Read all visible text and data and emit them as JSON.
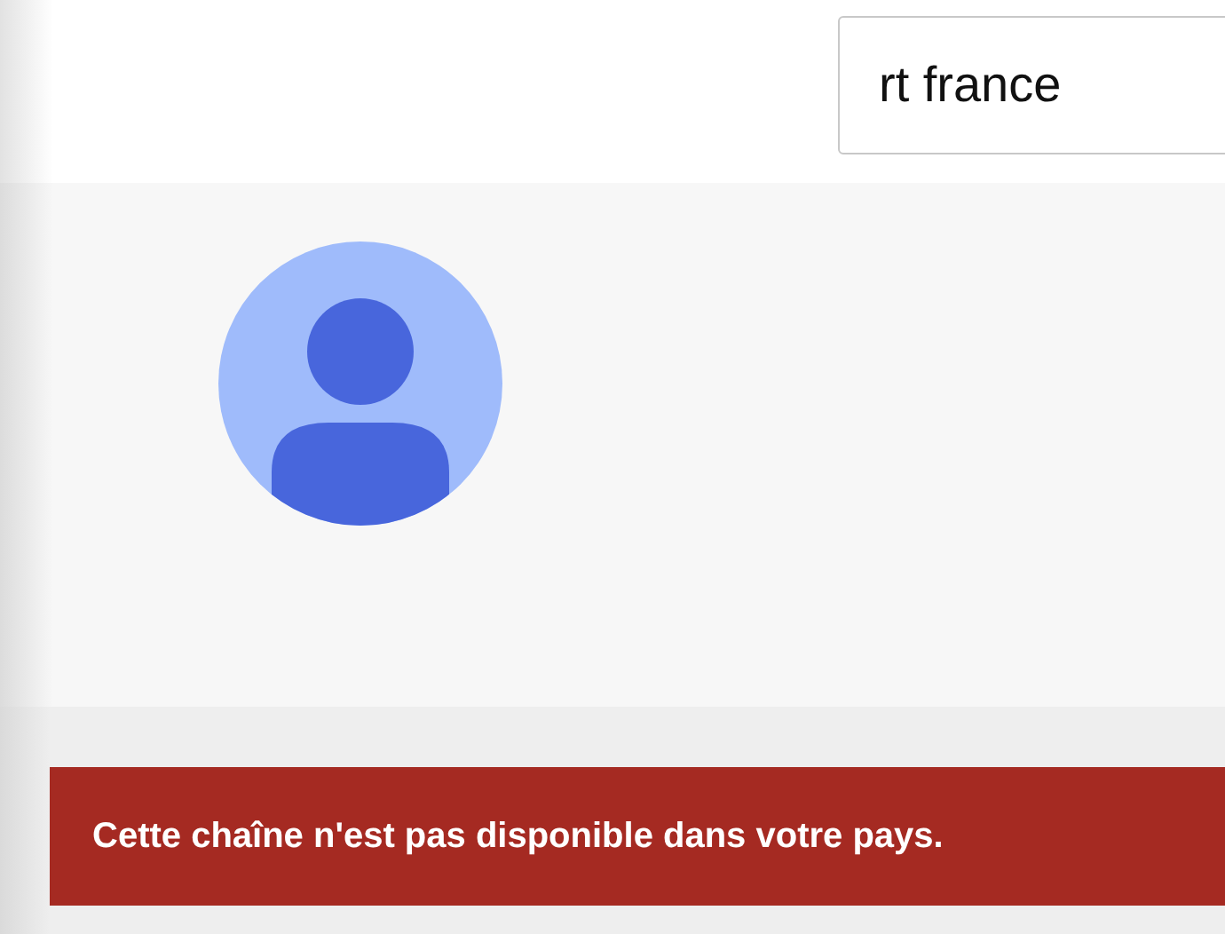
{
  "search": {
    "value": "rt france"
  },
  "notice": {
    "text": "Cette chaîne n'est pas disponible dans votre pays."
  }
}
